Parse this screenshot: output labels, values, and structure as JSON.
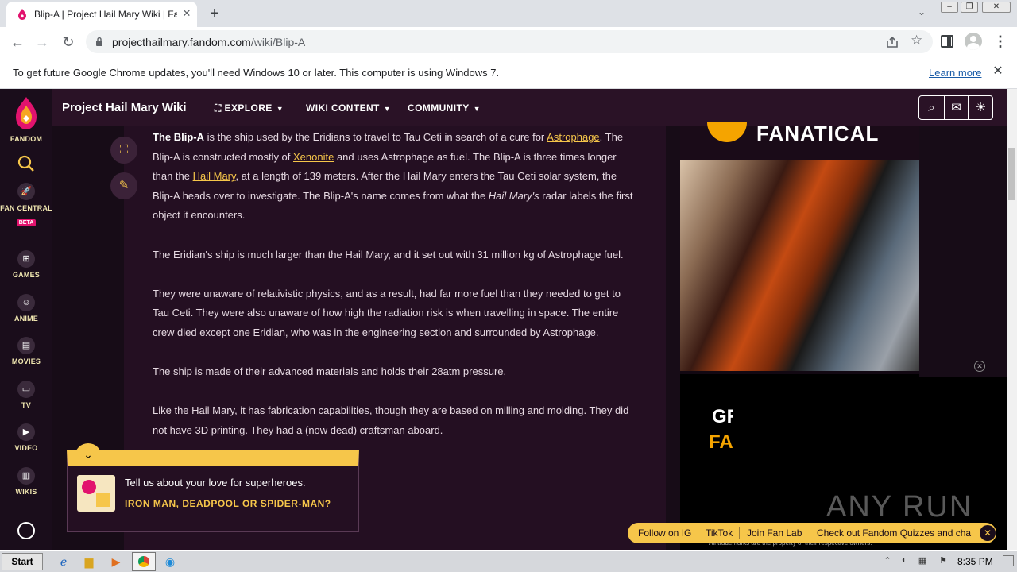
{
  "browser": {
    "tab_title": "Blip-A | Project Hail Mary Wiki | Fandom",
    "tab_close": "✕",
    "new_tab": "+",
    "url_host": "projecthailmary.fandom.com",
    "url_path": "/wiki/Blip-A",
    "infobar_text": "To get future Google Chrome updates, you'll need Windows 10 or later. This computer is using Windows 7.",
    "infobar_link": "Learn more"
  },
  "rail": {
    "fandom_label": "FANDOM",
    "items": [
      {
        "label": "FAN CENTRAL",
        "badge": "BETA"
      },
      {
        "label": "GAMES"
      },
      {
        "label": "ANIME"
      },
      {
        "label": "MOVIES"
      },
      {
        "label": "TV"
      },
      {
        "label": "VIDEO"
      },
      {
        "label": "WIKIS"
      }
    ]
  },
  "wikinav": {
    "title": "Project Hail Mary Wiki",
    "menus": [
      {
        "label": "EXPLORE"
      },
      {
        "label": "WIKI CONTENT"
      },
      {
        "label": "COMMUNITY"
      }
    ]
  },
  "article": {
    "p1_bold": "The Blip-A",
    "p1_a": " is the ship used by the Eridians to travel to Tau Ceti in search of a cure for ",
    "p1_link1": "Astrophage",
    "p1_b": ". The Blip-A is constructed mostly of ",
    "p1_link2": "Xenonite",
    "p1_c": " and uses Astrophage as fuel. The Blip-A is three times longer than the ",
    "p1_link3": "Hail Mary",
    "p1_d": ", at a length of 139 meters. After the Hail Mary enters the Tau Ceti solar system, the Blip-A heads over to investigate. The Blip-A's name comes from what the ",
    "p1_italic": "Hail Mary's",
    "p1_e": " radar labels the first object it encounters.",
    "p2": "The Eridian's ship is much larger than the Hail Mary, and it set out with 31 million kg of Astrophage fuel.",
    "p3": "They were unaware of relativistic physics, and as a result, had far more fuel than they needed to get to Tau Ceti. They were also unaware of how high the radiation risk is when travelling in space. The entire crew died except one Eridian, who was in the engineering section and surrounded by Astrophage.",
    "p4": "The ship is made of their advanced materials and holds their 28atm pressure.",
    "p5": "Like the Hail Mary, it has fabrication capabilities, though they are based on milling and molding. They did not have 3D printing. They had a (now dead) craftsman aboard."
  },
  "ads": {
    "top_text": "FANATICAL",
    "bottom_line1": "GR",
    "bottom_line2": "FA",
    "close": "✕",
    "trademark": "All trademarks are the property of their respective owners."
  },
  "popup": {
    "question": "Tell us about your love for superheroes.",
    "answer": "IRON MAN, DEADPOOL OR SPIDER-MAN?"
  },
  "fanbar": {
    "links": [
      "Follow on IG",
      "TikTok",
      "Join Fan Lab",
      "Check out Fandom Quizzes and cha"
    ]
  },
  "watermark": "ANY RUN",
  "taskbar": {
    "start": "Start",
    "clock": "8:35 PM"
  }
}
